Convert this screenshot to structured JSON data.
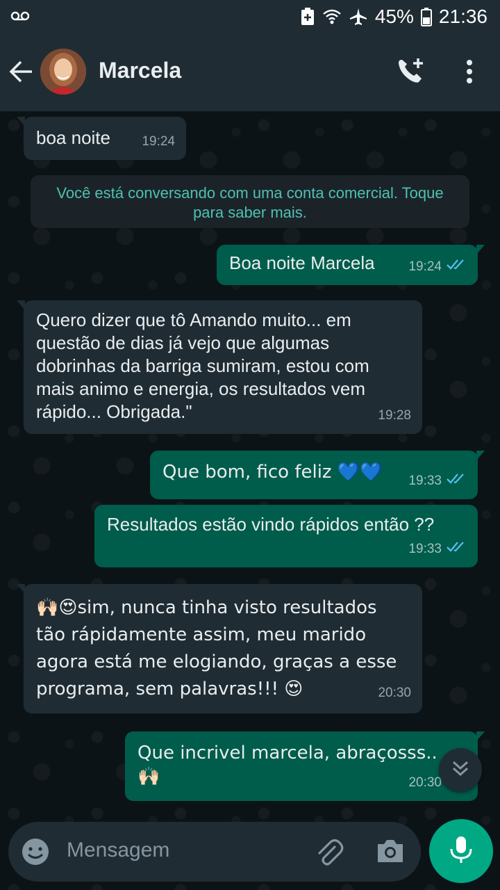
{
  "status_bar": {
    "voicemail_icon": "voicemail-icon",
    "battery_percent": "45%",
    "time": "21:36"
  },
  "header": {
    "contact_name": "Marcela",
    "icons": [
      "back-arrow-icon",
      "add-call-icon",
      "more-vert-icon"
    ]
  },
  "notice": "Você está conversando com uma conta comercial. Toque para saber mais.",
  "messages": [
    {
      "direction": "in",
      "text": "boa noite",
      "time": "19:24"
    },
    {
      "direction": "out",
      "text": "Boa noite Marcela",
      "time": "19:24",
      "status": "read"
    },
    {
      "direction": "in",
      "text": "Quero dizer que tô Amando muito... em questão de dias já vejo que algumas dobrinhas da barriga sumiram, estou com mais animo e energia, os resultados vem rápido... Obrigada.\"",
      "time": "19:28"
    },
    {
      "direction": "out",
      "text": "Que bom, fico feliz 💙💙",
      "time": "19:33",
      "status": "read"
    },
    {
      "direction": "out",
      "text": "Resultados estão vindo rápidos então ??",
      "time": "19:33",
      "status": "read"
    },
    {
      "direction": "in",
      "text": "🙌🏻😍sim, nunca tinha visto resultados tão rápidamente assim, meu marido agora está me elogiando, graças a esse programa, sem palavras!!! 😍",
      "time": "20:30"
    },
    {
      "direction": "out",
      "text": "Que incrivel marcela, abraçosss.. 🙌🏻",
      "time": "20:30",
      "status": "read"
    }
  ],
  "composer": {
    "placeholder": "Mensagem"
  },
  "colors": {
    "header": "#1f2c34",
    "incoming_bubble": "#1f2c33",
    "outgoing_bubble": "#005c4b",
    "accent": "#00a884",
    "read_ticks": "#53bdeb"
  }
}
